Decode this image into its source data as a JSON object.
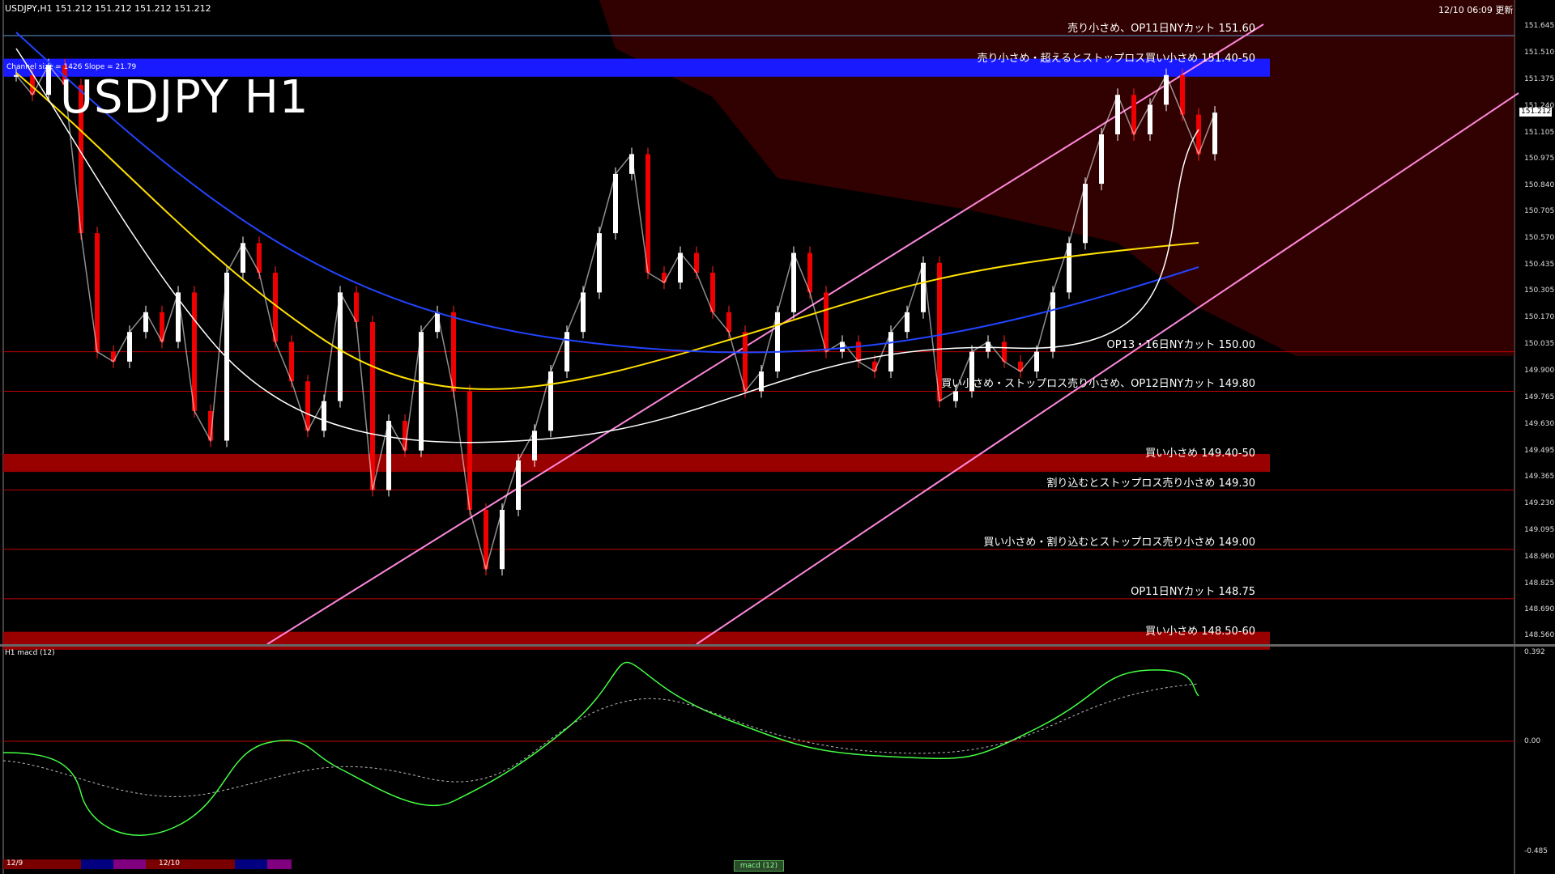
{
  "header": {
    "info_line": "USDJPY,H1  151.212 151.212 151.212 151.212",
    "channel_line": "Channel size = 1426 Slope = 21.79",
    "timestamp": "12/10 06:09 更新",
    "big_title": "USDJPY H1"
  },
  "levels": [
    {
      "price": 151.6,
      "label": "売り小さめ、OP11日NYカット 151.60",
      "color": "#5b9bd5",
      "kind": "line"
    },
    {
      "price": 151.45,
      "label": "売り小さめ・超えるとストップロス買い小さめ 151.40-50",
      "color": "#1a1aff",
      "kind": "band",
      "p2": 151.4
    },
    {
      "price": 150.0,
      "label": "OP13・16日NYカット 150.00",
      "color": "#c00000",
      "kind": "line"
    },
    {
      "price": 149.8,
      "label": "買い小さめ・ストップロス売り小さめ、OP12日NYカット 149.80",
      "color": "#c00000",
      "kind": "line"
    },
    {
      "price": 149.45,
      "label": "買い小さめ 149.40-50",
      "color": "#990000",
      "kind": "band",
      "p2": 149.4
    },
    {
      "price": 149.3,
      "label": "割り込むとストップロス売り小さめ 149.30",
      "color": "#c00000",
      "kind": "line"
    },
    {
      "price": 149.0,
      "label": "買い小さめ・割り込むとストップロス売り小さめ 149.00",
      "color": "#c00000",
      "kind": "line"
    },
    {
      "price": 148.75,
      "label": "OP11日NYカット 148.75",
      "color": "#c00000",
      "kind": "line"
    },
    {
      "price": 148.55,
      "label": "買い小さめ 148.50-60",
      "color": "#990000",
      "kind": "band",
      "p2": 148.5
    }
  ],
  "price_axis": {
    "ticks": [
      "151.645",
      "151.510",
      "151.375",
      "151.240",
      "151.105",
      "150.975",
      "150.840",
      "150.705",
      "150.570",
      "150.435",
      "150.305",
      "150.170",
      "150.035",
      "149.900",
      "149.765",
      "149.630",
      "149.495",
      "149.365",
      "149.230",
      "149.095",
      "148.960",
      "148.825",
      "148.690",
      "148.560"
    ],
    "current": "151.212"
  },
  "macd": {
    "label": "H1  macd (12)",
    "ticks": [
      "0.392",
      "0.00",
      "-0.485"
    ]
  },
  "dates": [
    "12/9",
    "12/10"
  ],
  "status": "macd (12)",
  "chart_data": {
    "type": "line",
    "title": "USDJPY H1",
    "ylim": [
      148.52,
      151.78
    ],
    "series": [
      {
        "name": "close",
        "values": [
          151.4,
          151.3,
          151.45,
          151.35,
          150.6,
          150.0,
          149.95,
          150.1,
          150.2,
          150.05,
          150.3,
          149.7,
          149.55,
          150.4,
          150.55,
          150.4,
          150.05,
          149.85,
          149.6,
          149.75,
          150.3,
          150.15,
          149.3,
          149.65,
          149.5,
          150.1,
          150.2,
          149.8,
          149.2,
          148.9,
          149.2,
          149.45,
          149.6,
          149.9,
          150.1,
          150.3,
          150.6,
          150.9,
          151.0,
          150.4,
          150.35,
          150.5,
          150.4,
          150.2,
          150.1,
          149.8,
          149.9,
          150.2,
          150.5,
          150.3,
          150.0,
          150.05,
          149.95,
          149.9,
          150.1,
          150.2,
          150.45,
          149.75,
          149.8,
          150.0,
          150.05,
          149.95,
          149.9,
          150.0,
          150.3,
          150.55,
          150.85,
          151.1,
          151.3,
          151.1,
          151.25,
          151.4,
          151.2,
          151.0,
          151.21
        ]
      }
    ]
  }
}
